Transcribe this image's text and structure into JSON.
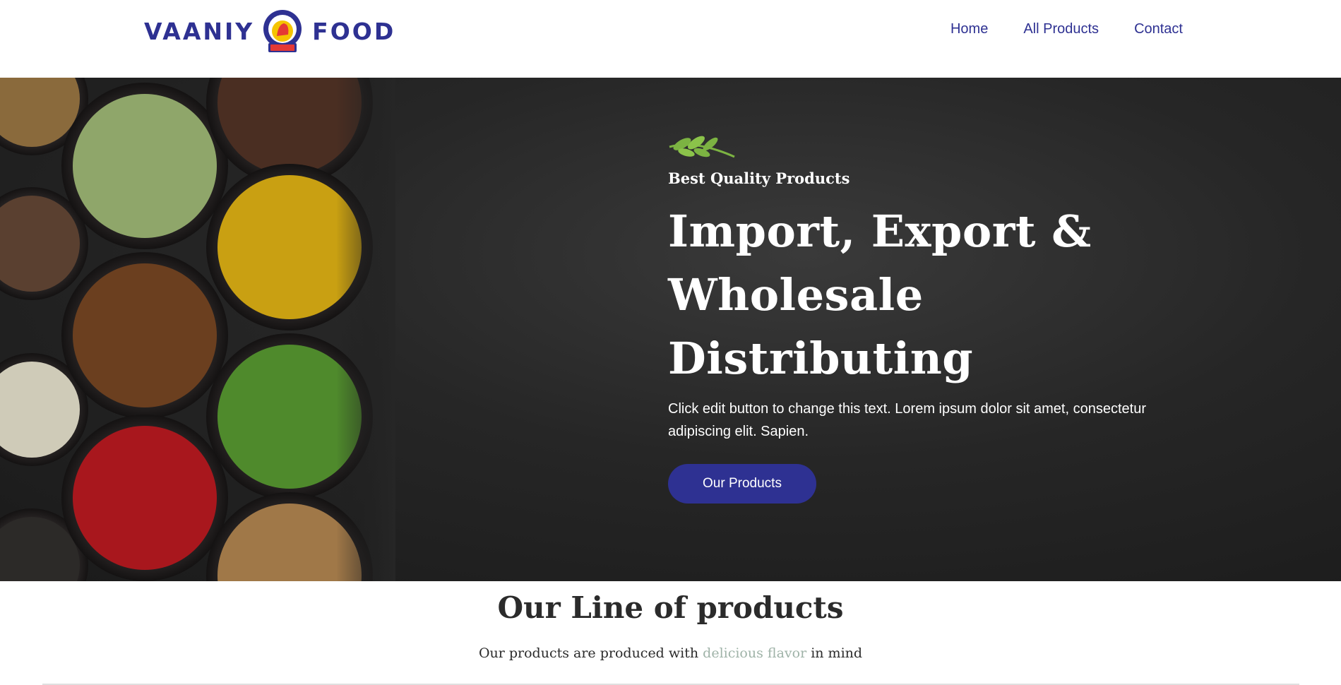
{
  "header": {
    "logo": {
      "left_text": "VAANIY",
      "right_text": "FOOD",
      "emblem_text": "VAANIY FOOD",
      "emblem_sub": "વાણી"
    },
    "nav": [
      {
        "label": "Home"
      },
      {
        "label": "All Products"
      },
      {
        "label": "Contact"
      }
    ]
  },
  "hero": {
    "kicker": "Best Quality Products",
    "headline_lines": [
      "Import, Export &",
      "Wholesale",
      "Distributing"
    ],
    "description": "Click edit button to change this text. Lorem ipsum dolor sit amet, consectetur adipiscing elit. Sapien.",
    "button_label": "Our Products"
  },
  "products_section": {
    "title": "Our Line of products",
    "subtitle_before": "Our products are produced with",
    "subtitle_highlight": "delicious flavor",
    "subtitle_after": "in mind"
  },
  "colors": {
    "brand": "#2e3192",
    "hero_bg": "#262626",
    "highlight": "#9fb3a8",
    "leaf": "#7cb342"
  }
}
